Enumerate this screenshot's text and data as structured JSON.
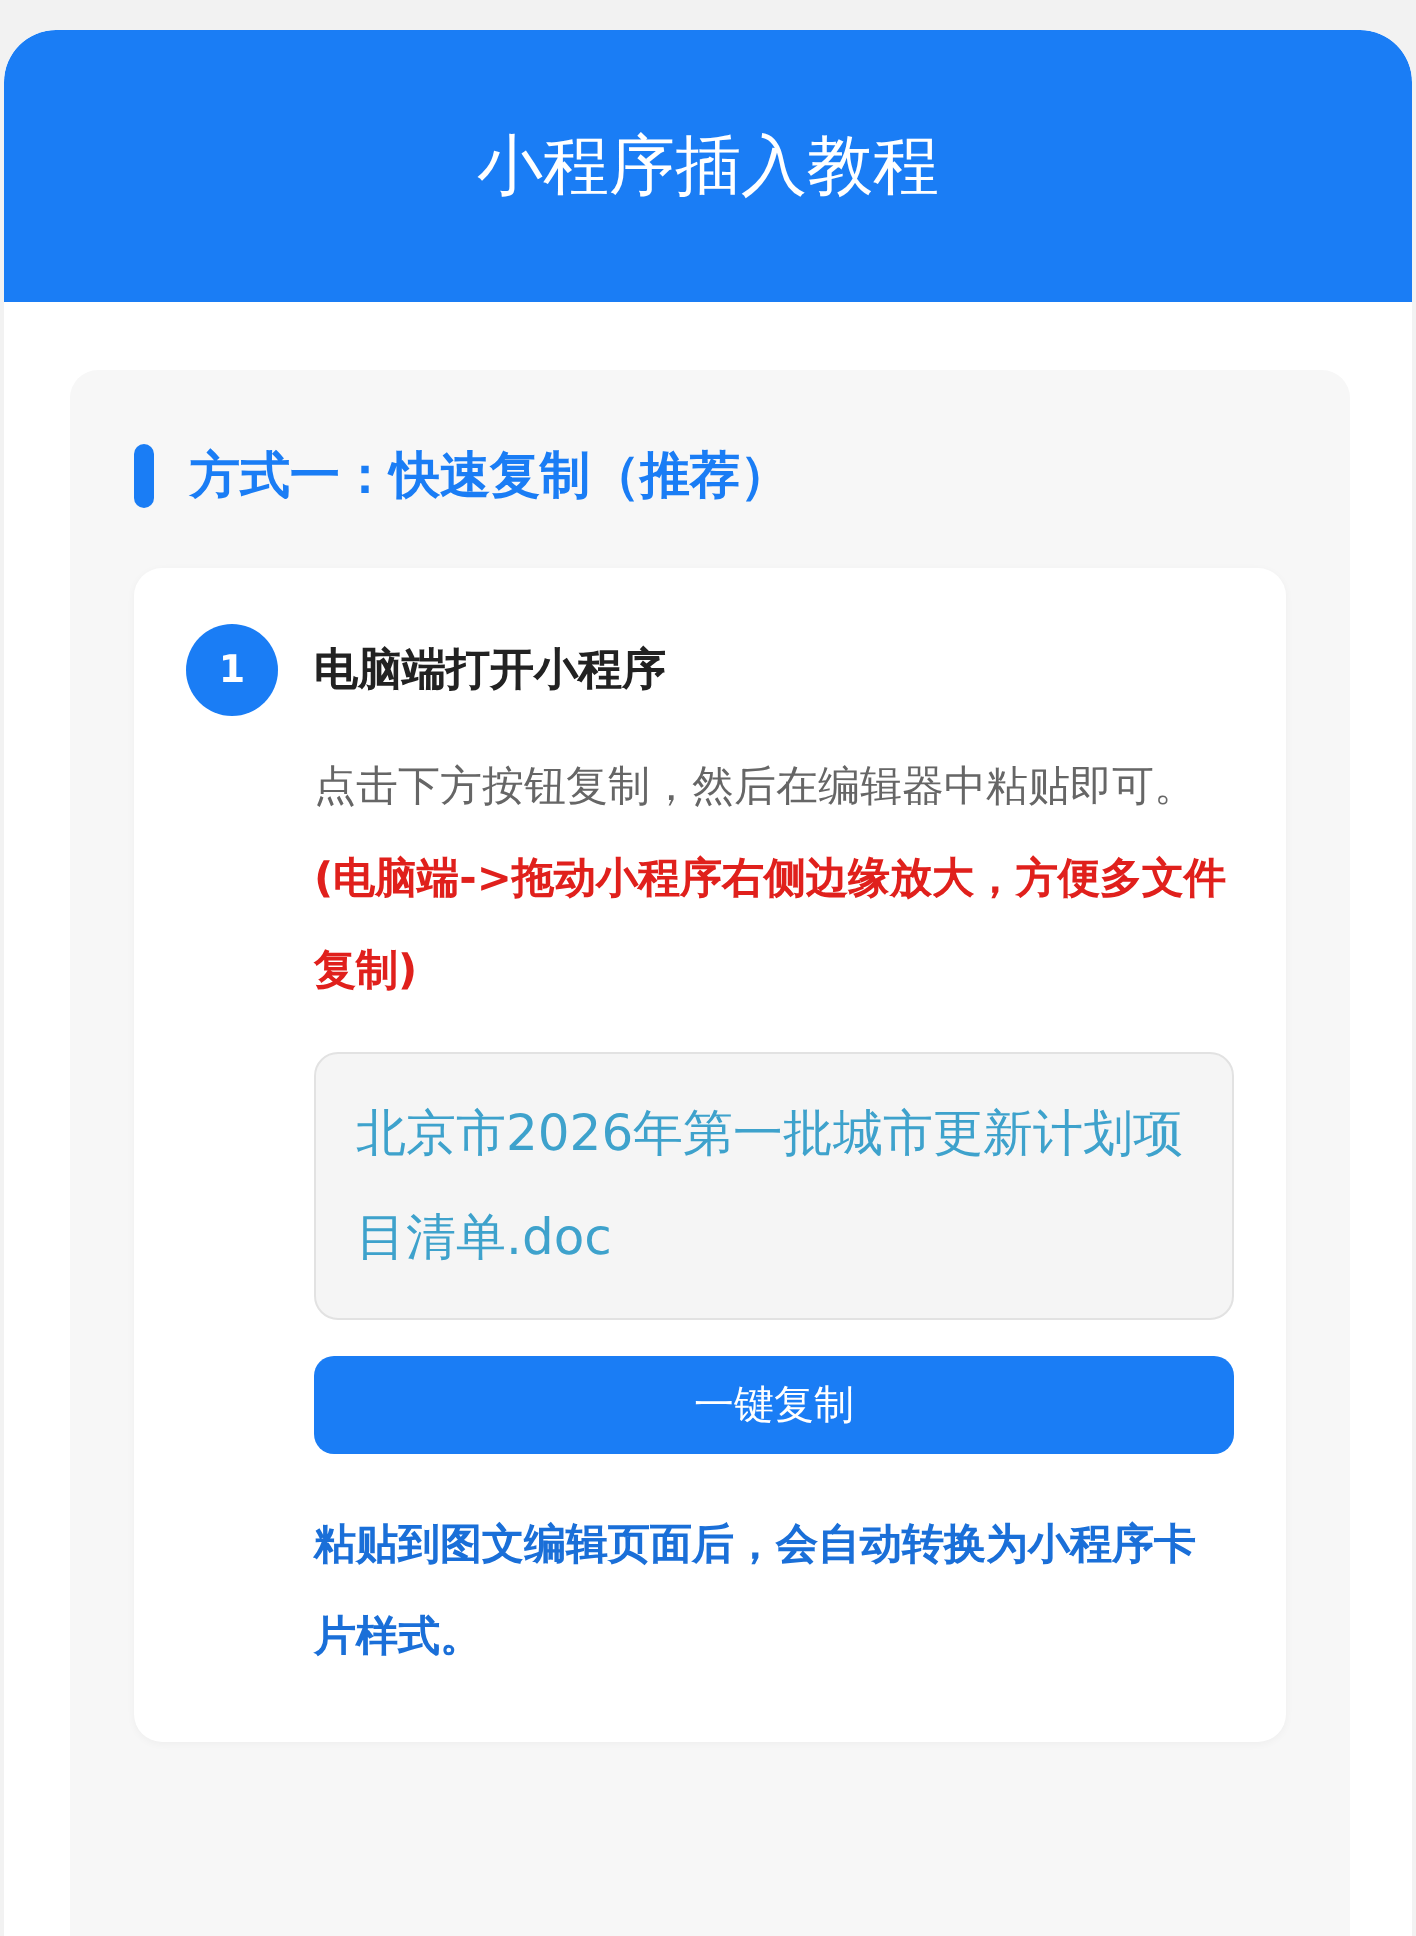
{
  "header": {
    "title": "小程序插入教程"
  },
  "section": {
    "title": "方式一：快速复制（推荐）",
    "steps": [
      {
        "number": "1",
        "title": "电脑端打开小程序",
        "description": "点击下方按钮复制，然后在编辑器中粘贴即可。**(电脑端->拖动小程序右侧边缘放大，方便多文件复制)**",
        "file_name": "北京市2026年第一批城市更新计划项目清单.doc",
        "button": "一键复制",
        "note": "粘贴到图文编辑页面后，会自动转换为小程序卡片样式。"
      }
    ]
  }
}
